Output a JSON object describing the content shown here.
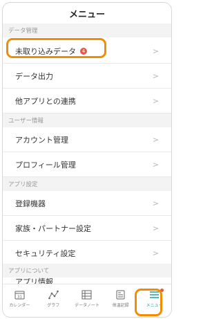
{
  "header": {
    "title": "メニュー"
  },
  "sections": {
    "data_management": "データ管理",
    "user_info": "ユーザー情報",
    "app_settings": "アプリ設定",
    "about_app": "アプリについて"
  },
  "items": {
    "unimported_data": {
      "label": "未取り込みデータ",
      "badge": "4"
    },
    "data_output": "データ出力",
    "other_app_link": "他アプリとの連携",
    "account_management": "アカウント管理",
    "profile_management": "プロフィール管理",
    "registered_devices": "登録機器",
    "family_partner_settings": "家族・パートナー設定",
    "security_settings": "セキュリティ設定",
    "app_info": "アプリ情報"
  },
  "tabs": [
    {
      "label": "カレンダー",
      "icon": "calendar-icon"
    },
    {
      "label": "グラフ",
      "icon": "graph-icon"
    },
    {
      "label": "データノート",
      "icon": "data-note-icon"
    },
    {
      "label": "体温記録",
      "icon": "temperature-record-icon"
    },
    {
      "label": "メニュー",
      "icon": "menu-icon"
    }
  ],
  "colors": {
    "accent": "#1aa3a6",
    "highlight": "#f28c00",
    "badge": "#e45a4a"
  }
}
